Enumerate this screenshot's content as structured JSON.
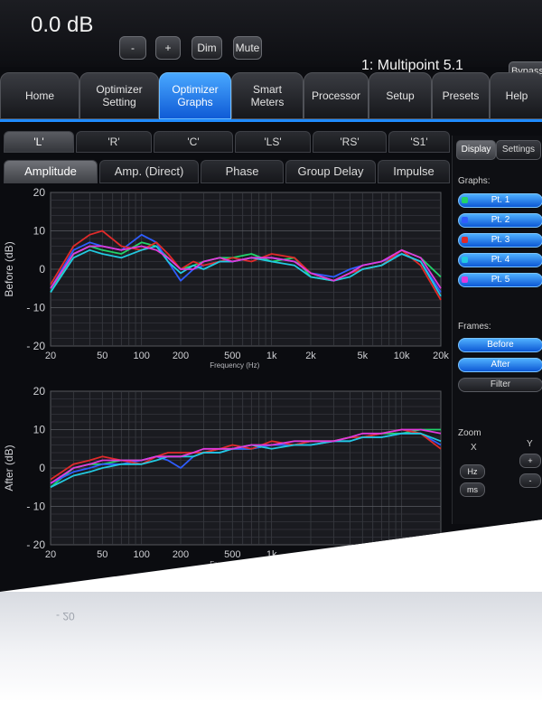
{
  "top": {
    "volume": "0.0 dB",
    "minus": "-",
    "plus": "+",
    "dim": "Dim",
    "mute": "Mute",
    "title": "1: Multipoint 5.1",
    "bypass": "Bypass"
  },
  "nav": [
    {
      "label": "Home"
    },
    {
      "label": "Optimizer\nSetting"
    },
    {
      "label": "Optimizer\nGraphs",
      "active": true
    },
    {
      "label": "Smart\nMeters"
    },
    {
      "label": "Processor"
    },
    {
      "label": "Setup"
    },
    {
      "label": "Presets"
    },
    {
      "label": "Help"
    }
  ],
  "channels": [
    "'L'",
    "'R'",
    "'C'",
    "'LS'",
    "'RS'",
    "'S1'"
  ],
  "graph_tabs": [
    "Amplitude",
    "Amp. (Direct)",
    "Phase",
    "Group Delay",
    "Impulse"
  ],
  "plots": {
    "before_label": "Before  (dB)",
    "after_label": "After  (dB)",
    "x_axis_label": "Frequency  (Hz)",
    "y_ticks": [
      "20",
      "10",
      "0",
      "- 10",
      "- 20"
    ],
    "x_ticks": [
      "20",
      "50",
      "100",
      "200",
      "500",
      "1k",
      "2k",
      "5k",
      "10k",
      "20k"
    ]
  },
  "panel": {
    "tab_display": "Display",
    "tab_settings": "Settings",
    "graphs_label": "Graphs:",
    "points": [
      "Pt. 1",
      "Pt. 2",
      "Pt. 3",
      "Pt. 4",
      "Pt. 5"
    ],
    "frames_label": "Frames:",
    "frames": [
      "Before",
      "After",
      "Filter"
    ],
    "zoom_label": "Zoom",
    "zoom_x": "X",
    "zoom_y": "Y",
    "hz": "Hz",
    "ms": "ms",
    "plus": "+",
    "minus": "-"
  },
  "colors": {
    "accent": "#1f8bff",
    "pt1": "#21d36a",
    "pt2": "#2f5dff",
    "pt3": "#e02a2a",
    "pt4": "#22c9e0",
    "pt5": "#e03adc"
  },
  "chart_data": [
    {
      "type": "line",
      "title": "Before",
      "ylabel": "Before (dB)",
      "xlabel": "Frequency (Hz)",
      "x_scale": "log",
      "xlim": [
        20,
        20000
      ],
      "ylim": [
        -20,
        20
      ],
      "x": [
        20,
        30,
        40,
        50,
        70,
        100,
        130,
        160,
        200,
        250,
        300,
        400,
        500,
        700,
        1000,
        1500,
        2000,
        3000,
        4000,
        5000,
        7000,
        10000,
        14000,
        20000
      ],
      "series": [
        {
          "name": "Pt. 1",
          "values": [
            -6,
            4,
            6,
            5,
            4,
            7,
            6,
            3,
            0,
            1,
            2,
            3,
            3,
            4,
            2,
            3,
            -2,
            -3,
            -1,
            0,
            1,
            5,
            3,
            -2
          ]
        },
        {
          "name": "Pt. 2",
          "values": [
            -5,
            5,
            7,
            6,
            5,
            9,
            7,
            2,
            -3,
            0,
            1,
            2,
            2,
            3,
            3,
            2,
            -1,
            -2,
            0,
            1,
            2,
            4,
            2,
            -6
          ]
        },
        {
          "name": "Pt. 3",
          "values": [
            -4,
            6,
            9,
            10,
            6,
            5,
            7,
            4,
            0,
            2,
            1,
            2,
            3,
            2,
            4,
            3,
            -1,
            -3,
            -1,
            0,
            1,
            5,
            1,
            -8
          ]
        },
        {
          "name": "Pt. 4",
          "values": [
            -6,
            3,
            5,
            4,
            3,
            5,
            6,
            2,
            -1,
            1,
            0,
            2,
            2,
            3,
            2,
            1,
            -2,
            -3,
            -2,
            0,
            1,
            4,
            2,
            -7
          ]
        },
        {
          "name": "Pt. 5",
          "values": [
            -5,
            4,
            6,
            6,
            5,
            6,
            5,
            3,
            0,
            0,
            2,
            3,
            2,
            3,
            3,
            2,
            -1,
            -3,
            -1,
            1,
            2,
            5,
            3,
            -5
          ]
        }
      ]
    },
    {
      "type": "line",
      "title": "After",
      "ylabel": "After (dB)",
      "xlabel": "Frequency (Hz)",
      "x_scale": "log",
      "xlim": [
        20,
        20000
      ],
      "ylim": [
        -20,
        20
      ],
      "x": [
        20,
        30,
        40,
        50,
        70,
        100,
        130,
        160,
        200,
        250,
        300,
        400,
        500,
        700,
        1000,
        1500,
        2000,
        3000,
        4000,
        5000,
        7000,
        10000,
        14000,
        20000
      ],
      "series": [
        {
          "name": "Pt. 1",
          "values": [
            -5,
            0,
            1,
            1,
            2,
            2,
            3,
            3,
            3,
            4,
            4,
            5,
            5,
            5,
            6,
            6,
            7,
            7,
            8,
            8,
            9,
            9,
            10,
            10
          ]
        },
        {
          "name": "Pt. 2",
          "values": [
            -4,
            -1,
            0,
            1,
            1,
            2,
            3,
            2,
            0,
            3,
            4,
            4,
            5,
            5,
            6,
            6,
            6,
            7,
            7,
            8,
            8,
            9,
            9,
            6
          ]
        },
        {
          "name": "Pt. 3",
          "values": [
            -3,
            1,
            2,
            3,
            2,
            1,
            3,
            4,
            4,
            4,
            4,
            5,
            6,
            5,
            7,
            6,
            7,
            7,
            8,
            8,
            9,
            10,
            9,
            5
          ]
        },
        {
          "name": "Pt. 4",
          "values": [
            -5,
            -2,
            -1,
            0,
            1,
            1,
            2,
            3,
            3,
            3,
            4,
            4,
            5,
            6,
            5,
            6,
            6,
            7,
            7,
            8,
            8,
            9,
            9,
            7
          ]
        },
        {
          "name": "Pt. 5",
          "values": [
            -4,
            0,
            1,
            2,
            2,
            2,
            3,
            3,
            3,
            4,
            5,
            5,
            5,
            6,
            6,
            7,
            7,
            7,
            8,
            9,
            9,
            10,
            10,
            9
          ]
        }
      ]
    }
  ]
}
